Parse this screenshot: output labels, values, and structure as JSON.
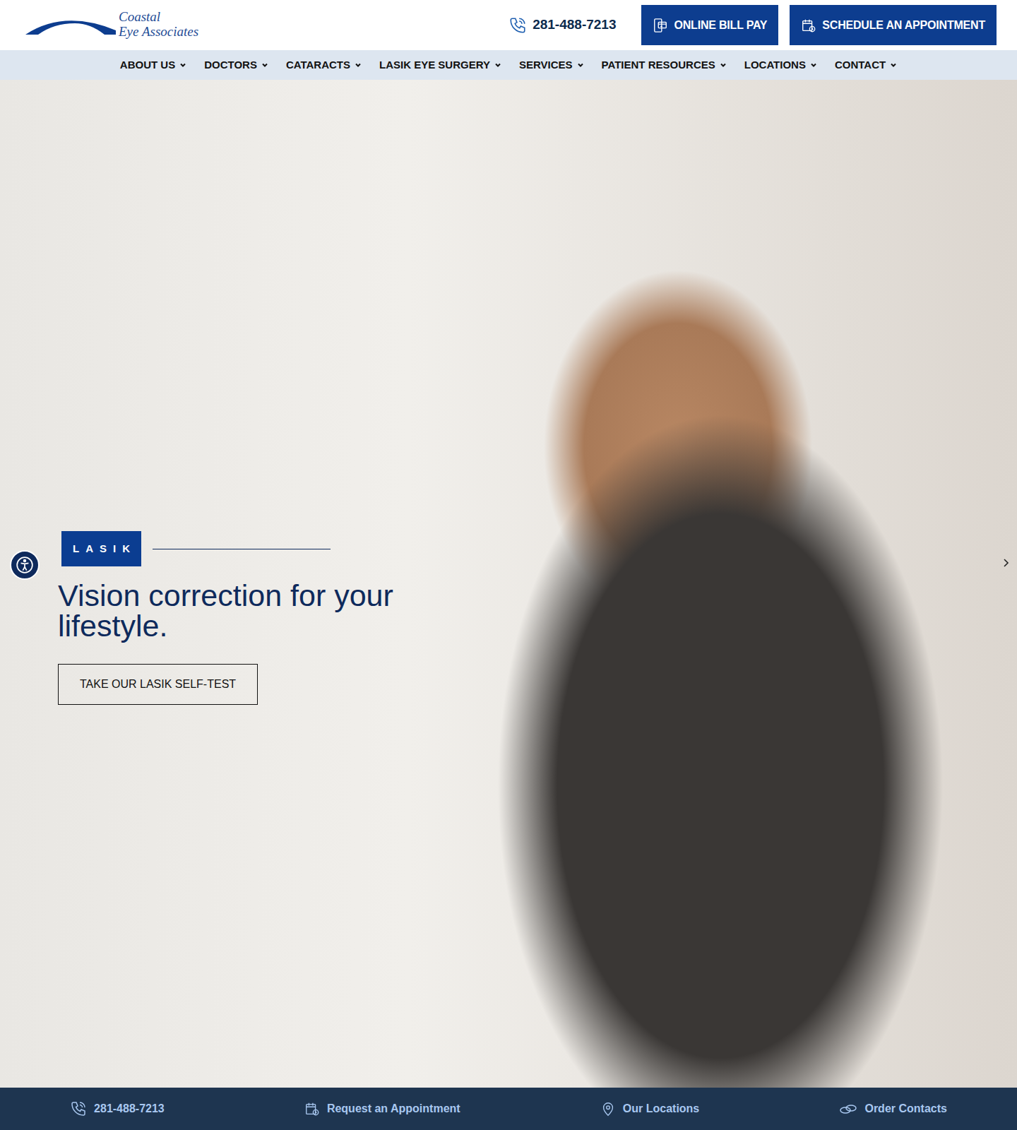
{
  "logo": {
    "line1": "Coastal",
    "line2": "Eye Associates"
  },
  "header": {
    "phone": "281-488-7213",
    "buttons": [
      "ONLINE BILL PAY",
      "SCHEDULE AN APPOINTMENT"
    ]
  },
  "nav": {
    "items": [
      "ABOUT US",
      "DOCTORS",
      "CATARACTS",
      "LASIK EYE SURGERY",
      "SERVICES",
      "PATIENT RESOURCES",
      "LOCATIONS",
      "CONTACT"
    ]
  },
  "hero": {
    "badge": "LASIK",
    "heading": "Vision correction for your lifestyle.",
    "cta": "TAKE OUR LASIK SELF-TEST"
  },
  "bottom_bar": {
    "items": [
      "281-488-7213",
      "Request an Appointment",
      "Our Locations",
      "Order Contacts"
    ]
  }
}
